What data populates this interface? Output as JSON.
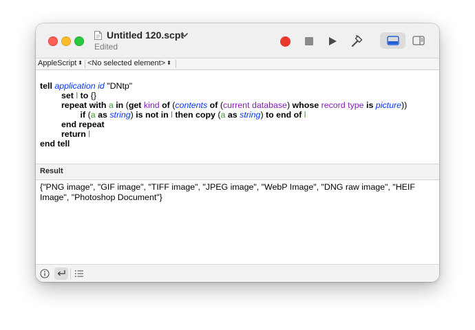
{
  "window": {
    "title": "Untitled 120.scpt",
    "subtitle": "Edited"
  },
  "toolbar": {
    "record_icon": "record-icon",
    "stop_icon": "stop-icon",
    "run_icon": "play-icon",
    "compile_icon": "hammer-icon",
    "view_left_icon": "bottom-panel-icon",
    "view_right_icon": "sidebar-panel-icon",
    "record_color": "#e8382f"
  },
  "navbar": {
    "language": "AppleScript",
    "element": "<No selected element>"
  },
  "code": {
    "l1_tell": "tell",
    "l1_application": "application",
    "l1_id": "id",
    "l1_string": "\"DNtp\"",
    "l2_set": "set",
    "l2_var": "l",
    "l2_to": "to",
    "l2_value": "{}",
    "l3_repeat": "repeat with",
    "l3_var": "a",
    "l3_in": "in",
    "l3_paren1": "(",
    "l3_get": "get",
    "l3_kind": "kind",
    "l3_of1": "of",
    "l3_paren2": "(",
    "l3_contents": "contents",
    "l3_of2": "of",
    "l3_paren3": "(",
    "l3_curdb": "current database",
    "l3_paren4": ")",
    "l3_whose": "whose",
    "l3_rectype": "record type",
    "l3_is": "is",
    "l3_picture": "picture",
    "l3_close": "))",
    "l4_if": "if",
    "l4_paren1": "(",
    "l4_var": "a",
    "l4_as": "as",
    "l4_string": "string",
    "l4_paren2": ")",
    "l4_isnotin": "is not in",
    "l4_l": "l",
    "l4_then": "then copy",
    "l4_paren3": "(",
    "l4_var2": "a",
    "l4_as2": "as",
    "l4_string2": "string",
    "l4_paren4": ")",
    "l4_toendof": "to end of",
    "l4_l2": "l",
    "l5_endrepeat": "end repeat",
    "l6_return": "return",
    "l6_l": "l",
    "l7_endtell": "end tell"
  },
  "result": {
    "header": "Result",
    "text": "{\"PNG image\", \"GIF image\", \"TIFF image\", \"JPEG image\", \"WebP Image\", \"DNG raw image\", \"HEIF Image\", \"Photoshop Document\"}"
  },
  "bottombar": {
    "info_icon": "info-icon",
    "reply_icon": "reply-arrow-icon",
    "log_icon": "list-icon"
  }
}
